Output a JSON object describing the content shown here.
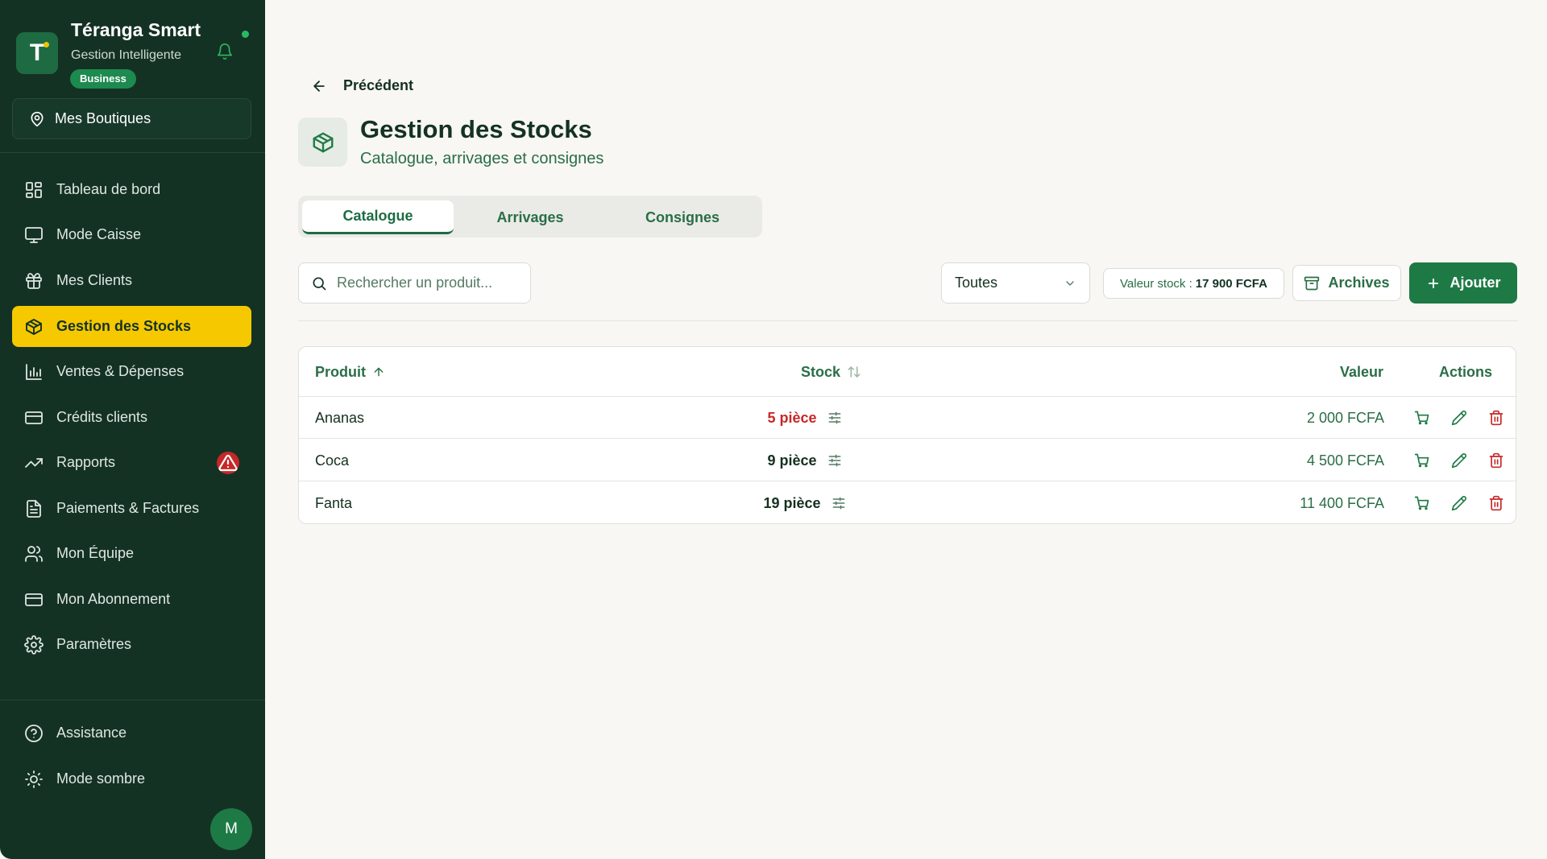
{
  "sidebar": {
    "app_title": "Téranga Smart",
    "app_subtitle": "Gestion Intelligente",
    "plan_badge": "Business",
    "brand_letter": "T",
    "shops_label": "Mes Boutiques",
    "items": [
      {
        "label": "Tableau de bord",
        "icon": "dashboard-icon"
      },
      {
        "label": "Mode Caisse",
        "icon": "monitor-icon"
      },
      {
        "label": "Mes Clients",
        "icon": "gift-icon"
      },
      {
        "label": "Gestion des Stocks",
        "icon": "package-icon",
        "active": true
      },
      {
        "label": "Ventes & Dépenses",
        "icon": "bar-chart-icon"
      },
      {
        "label": "Crédits clients",
        "icon": "credit-card-icon"
      },
      {
        "label": "Rapports",
        "icon": "trending-up-icon",
        "alert": true
      },
      {
        "label": "Paiements & Factures",
        "icon": "document-icon"
      },
      {
        "label": "Mon Équipe",
        "icon": "users-icon"
      },
      {
        "label": "Mon Abonnement",
        "icon": "credit-card-icon"
      },
      {
        "label": "Paramètres",
        "icon": "gear-icon"
      }
    ],
    "footer": [
      {
        "label": "Assistance",
        "icon": "help-icon"
      },
      {
        "label": "Mode sombre",
        "icon": "sun-icon"
      }
    ],
    "avatar_initial": "M"
  },
  "header": {
    "back_label": "Précédent",
    "title": "Gestion des Stocks",
    "subtitle": "Catalogue, arrivages et consignes"
  },
  "tabs": [
    {
      "label": "Catalogue",
      "active": true
    },
    {
      "label": "Arrivages",
      "active": false
    },
    {
      "label": "Consignes",
      "active": false
    }
  ],
  "toolbar": {
    "search_placeholder": "Rechercher un produit...",
    "filter_value": "Toutes",
    "stock_value_label": "Valeur stock :",
    "stock_value_amount": "17 900 FCFA",
    "archives_label": "Archives",
    "add_label": "Ajouter"
  },
  "table": {
    "columns": {
      "product": "Produit",
      "stock": "Stock",
      "value": "Valeur",
      "actions": "Actions"
    },
    "rows": [
      {
        "product": "Ananas",
        "stock": "5 pièce",
        "low": true,
        "value": "2 000 FCFA"
      },
      {
        "product": "Coca",
        "stock": "9 pièce",
        "low": false,
        "value": "4 500 FCFA"
      },
      {
        "product": "Fanta",
        "stock": "19 pièce",
        "low": false,
        "value": "11 400 FCFA"
      }
    ]
  },
  "colors": {
    "sidebar_bg": "#143224",
    "active_nav": "#f5c800",
    "accent_green": "#1e7a45",
    "danger_red": "#c62828"
  }
}
